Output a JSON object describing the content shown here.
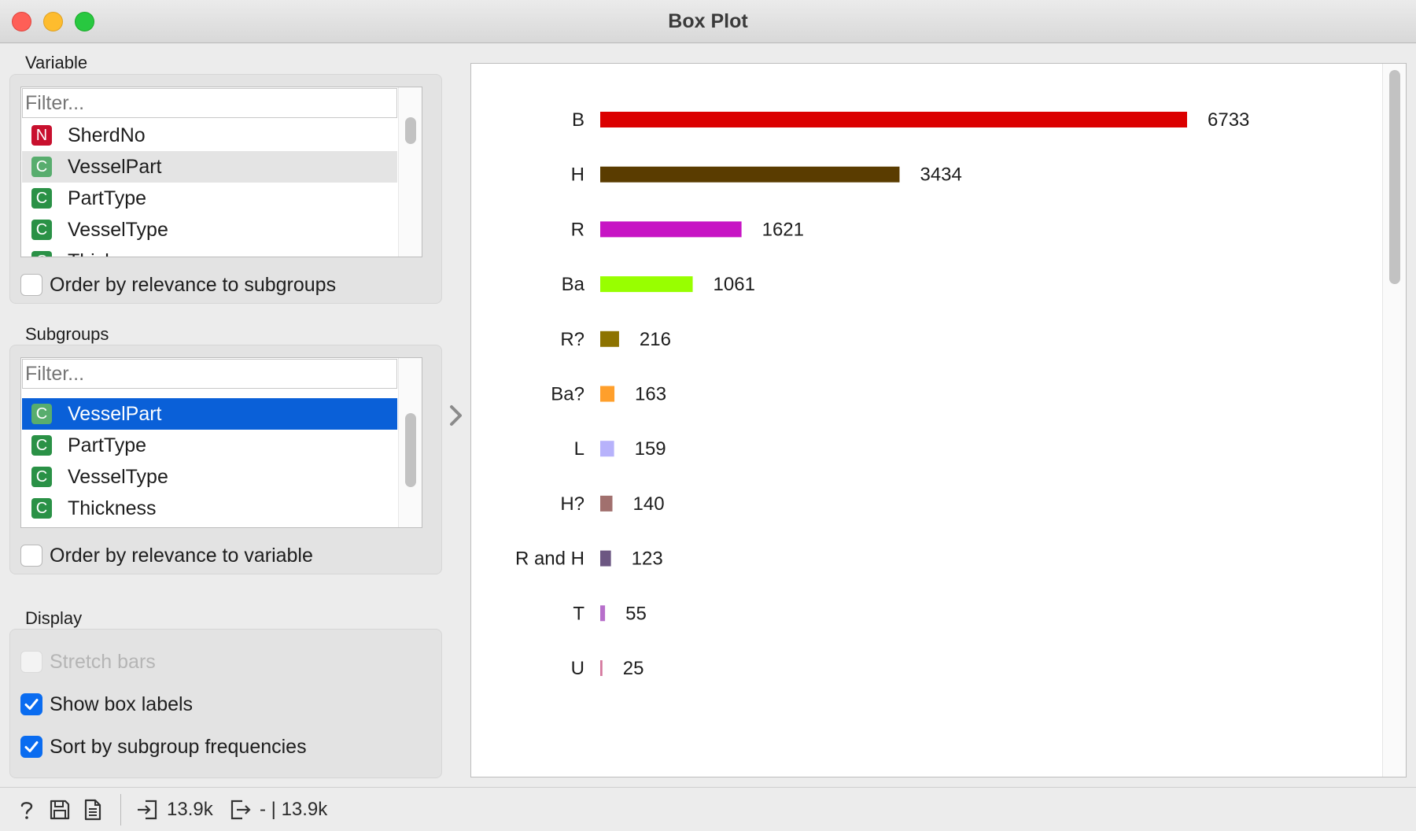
{
  "window": {
    "title": "Box Plot"
  },
  "variable": {
    "label": "Variable",
    "filter_placeholder": "Filter...",
    "items": [
      {
        "badge": "N",
        "type": "numeric",
        "label": "SherdNo"
      },
      {
        "badge": "C",
        "type": "categorical",
        "label": "VesselPart"
      },
      {
        "badge": "C",
        "type": "categorical",
        "label": "PartType"
      },
      {
        "badge": "C",
        "type": "categorical",
        "label": "VesselType"
      },
      {
        "badge": "C",
        "type": "categorical",
        "label": "Thickness"
      }
    ],
    "highlighted": "VesselPart",
    "order_label": "Order by relevance to subgroups",
    "order_checked": false
  },
  "subgroups": {
    "label": "Subgroups",
    "filter_placeholder": "Filter...",
    "items": [
      {
        "badge": "C",
        "type": "categorical",
        "label": "VesselPart"
      },
      {
        "badge": "C",
        "type": "categorical",
        "label": "PartType"
      },
      {
        "badge": "C",
        "type": "categorical",
        "label": "VesselType"
      },
      {
        "badge": "C",
        "type": "categorical",
        "label": "Thickness"
      }
    ],
    "selected": "VesselPart",
    "order_label": "Order by relevance to variable",
    "order_checked": false
  },
  "display": {
    "label": "Display",
    "stretch_bars_label": "Stretch bars",
    "stretch_bars_checked": false,
    "stretch_bars_enabled": false,
    "show_box_labels_label": "Show box labels",
    "show_box_labels_checked": true,
    "sort_label": "Sort by subgroup frequencies",
    "sort_checked": true
  },
  "statusbar": {
    "icons": [
      "help-icon",
      "save-icon",
      "report-icon"
    ],
    "input_count": "13.9k",
    "output_count": "- | 13.9k"
  },
  "chart_data": {
    "type": "bar",
    "orientation": "horizontal",
    "categories": [
      "B",
      "H",
      "R",
      "Ba",
      "R?",
      "Ba?",
      "L",
      "H?",
      "R and H",
      "T",
      "U"
    ],
    "values": [
      6733,
      3434,
      1621,
      1061,
      216,
      163,
      159,
      140,
      123,
      55,
      25
    ],
    "colors": [
      "#db0000",
      "#5a3c00",
      "#c714c4",
      "#98ff00",
      "#8d7300",
      "#ff9f2b",
      "#b7b2fb",
      "#a1706e",
      "#6c5782",
      "#b76fcb",
      "#d5789e"
    ],
    "show_value_labels": true
  }
}
